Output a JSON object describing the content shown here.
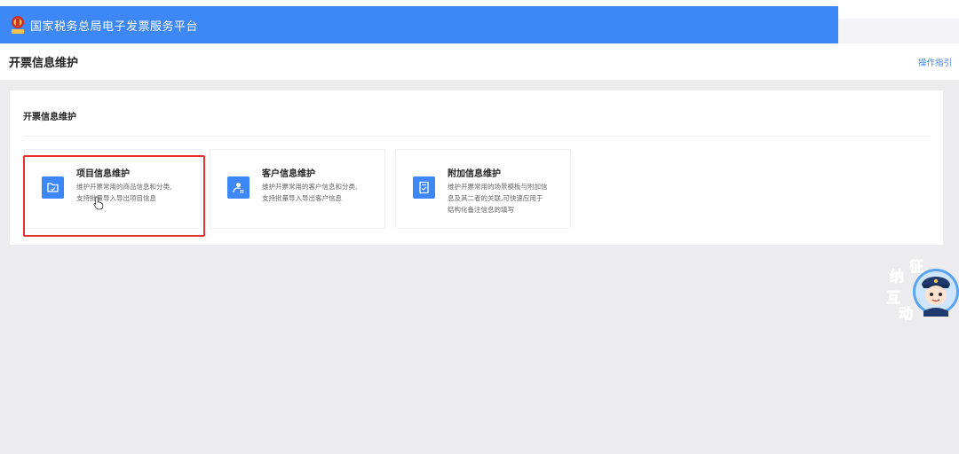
{
  "app": {
    "title": "国家税务总局电子发票服务平台"
  },
  "page": {
    "title": "开票信息维护",
    "guide_link": "操作指引"
  },
  "section": {
    "title": "开票信息维护"
  },
  "cards": [
    {
      "title": "项目信息维护",
      "desc_line1": "维护开票常用的商品信息和分类,",
      "desc_line2": "支持批量导入导出项目信息"
    },
    {
      "title": "客户信息维护",
      "desc_line1": "维护开票常用的客户信息和分类,",
      "desc_line2": "支持批量导入导出客户信息"
    },
    {
      "title": "附加信息维护",
      "desc_line1": "维护开票常用的场景模板与附加信",
      "desc_line2": "息及其二者的关联,可快速应用于",
      "desc_line3": "结构化备注信息的填写"
    }
  ],
  "widget": {
    "chars": [
      "征",
      "纳",
      "互",
      "动"
    ]
  },
  "colors": {
    "header": "#3d87f6",
    "icon_bg": "#3d87f6",
    "highlight": "#e4332f",
    "background": "#ececef"
  },
  "icons": {
    "emblem": "tax-emblem-icon",
    "card1": "folder-icon",
    "card2": "contact-card-icon",
    "card3": "document-icon"
  }
}
